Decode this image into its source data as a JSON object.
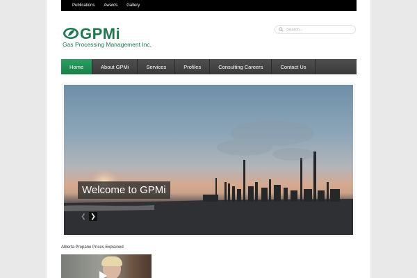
{
  "topbar": {
    "links": [
      "Publications",
      "Awards",
      "Gallery"
    ]
  },
  "logo": {
    "name": "GPMi",
    "subtitle": "Gas Processing Management Inc.",
    "brand_color": "#1d7a4e"
  },
  "search": {
    "placeholder": "Search..."
  },
  "nav": {
    "items": [
      "Home",
      "About GPMi",
      "Services",
      "Profiles",
      "Consulting Careers",
      "Contact Us"
    ],
    "active": "Home",
    "active_color": "#1b7f48"
  },
  "slider": {
    "caption": "Welcome to GPMi",
    "prev_icon": "chevron-left-icon",
    "next_icon": "chevron-right-icon"
  },
  "featured": {
    "title": "Alberta Propane Prices Explained",
    "video_icon": "play-icon"
  }
}
